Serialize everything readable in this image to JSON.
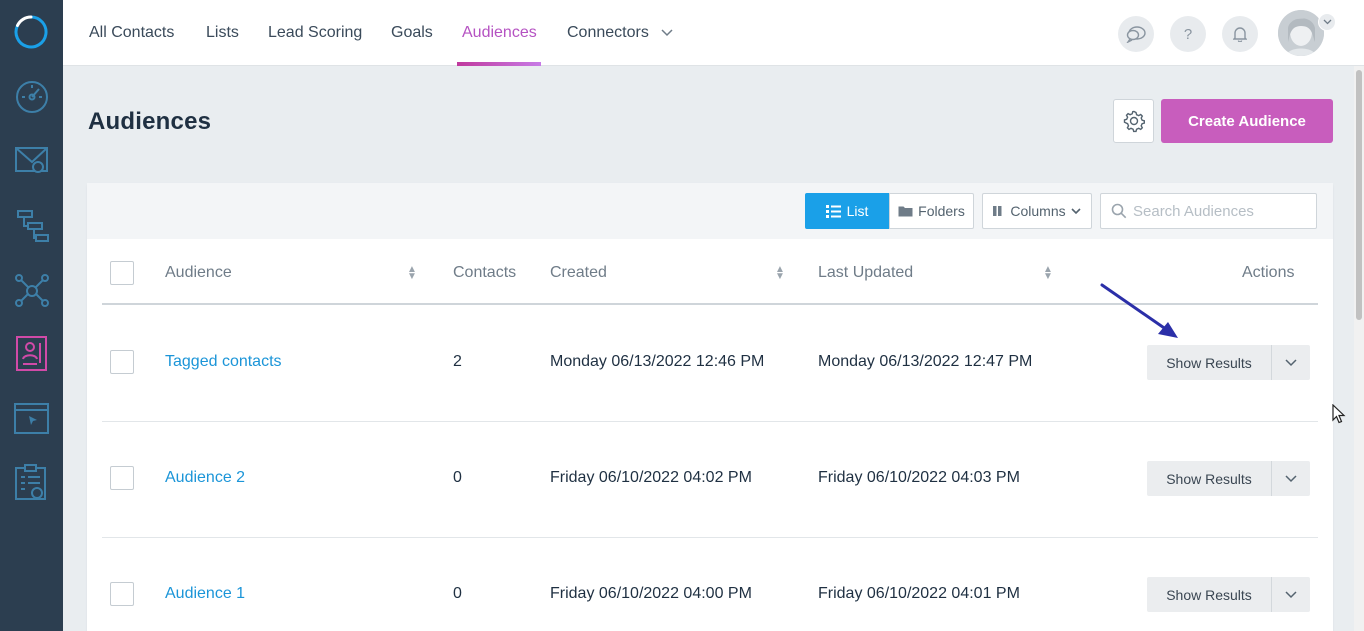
{
  "nav": {
    "tabs": [
      {
        "label": "All Contacts"
      },
      {
        "label": "Lists"
      },
      {
        "label": "Lead Scoring"
      },
      {
        "label": "Goals"
      },
      {
        "label": "Audiences"
      },
      {
        "label": "Connectors"
      }
    ],
    "active_tab": "Audiences",
    "help_label": "?"
  },
  "sidebar": {
    "icons": [
      "dashboard-icon",
      "email-icon",
      "automation-icon",
      "network-icon",
      "audience-icon",
      "landing-page-icon",
      "forms-icon"
    ],
    "active": "audience-icon"
  },
  "page": {
    "title": "Audiences",
    "create_label": "Create Audience"
  },
  "toolbar": {
    "list_label": "List",
    "folders_label": "Folders",
    "columns_label": "Columns",
    "search_placeholder": "Search Audiences"
  },
  "table": {
    "headers": {
      "audience": "Audience",
      "contacts": "Contacts",
      "created": "Created",
      "last_updated": "Last Updated",
      "actions": "Actions"
    },
    "rows": [
      {
        "name": "Tagged contacts",
        "contacts": "2",
        "created": "Monday 06/13/2022 12:46 PM",
        "updated": "Monday 06/13/2022 12:47 PM",
        "action": "Show Results"
      },
      {
        "name": "Audience 2",
        "contacts": "0",
        "created": "Friday 06/10/2022 04:02 PM",
        "updated": "Friday 06/10/2022 04:03 PM",
        "action": "Show Results"
      },
      {
        "name": "Audience 1",
        "contacts": "0",
        "created": "Friday 06/10/2022 04:00 PM",
        "updated": "Friday 06/10/2022 04:01 PM",
        "action": "Show Results"
      }
    ]
  },
  "colors": {
    "sidebar_bg": "#2c3e50",
    "accent_pink": "#c85dbd",
    "active_tab": "#b552c2",
    "link_blue": "#1b95d8",
    "list_btn": "#1aa0e8",
    "annotation_arrow": "#2b2fa8"
  }
}
